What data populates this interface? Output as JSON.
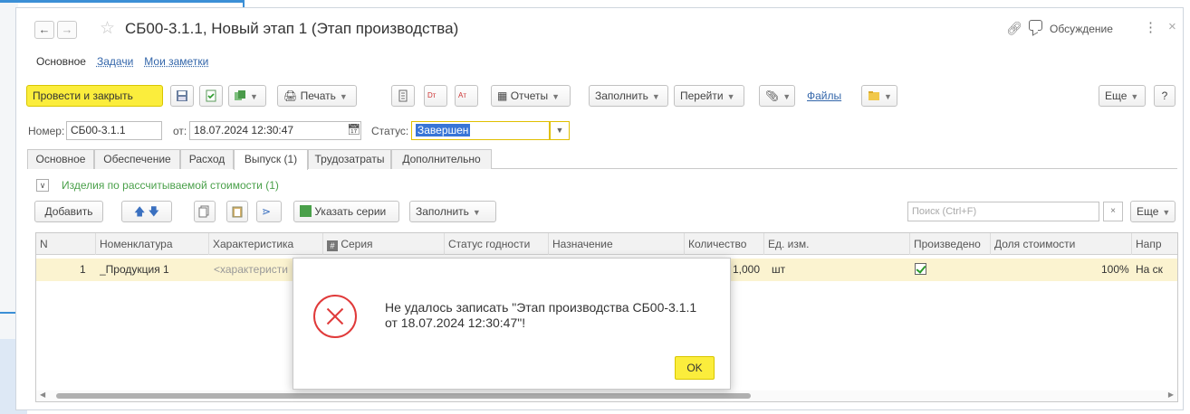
{
  "window": {
    "title": "СБ00-3.1.1, Новый этап 1 (Этап производства)",
    "discussion_label": "Обсуждение"
  },
  "subnav": {
    "items": [
      "Основное",
      "Задачи",
      "Мои заметки"
    ]
  },
  "toolbar": {
    "post_close": "Провести и закрыть",
    "print": "Печать",
    "reports": "Отчеты",
    "fill": "Заполнить",
    "goto": "Перейти",
    "files": "Файлы",
    "more": "Еще",
    "help": "?"
  },
  "header": {
    "number_label": "Номер:",
    "number_value": "СБ00-3.1.1",
    "from_label": "от:",
    "date_value": "18.07.2024 12:30:47",
    "status_label": "Статус:",
    "status_value": "Завершен"
  },
  "doc_tabs": [
    "Основное",
    "Обеспечение",
    "Расход",
    "Выпуск (1)",
    "Трудозатраты",
    "Дополнительно"
  ],
  "group": {
    "title": "Изделия по рассчитываемой стоимости (1)"
  },
  "table_toolbar": {
    "add": "Добавить",
    "specify_series": "Указать серии",
    "fill": "Заполнить",
    "search_placeholder": "Поиск (Ctrl+F)",
    "more": "Еще"
  },
  "grid": {
    "columns": [
      "N",
      "Номенклатура",
      "Характеристика",
      "Серия",
      "Статус годности",
      "Назначение",
      "Количество",
      "Ед. изм.",
      "Произведено",
      "Доля стоимости",
      "Напр"
    ],
    "rows": [
      {
        "n": "1",
        "nomenclature": "_Продукция 1",
        "characteristic": "<характеристи",
        "quantity": "1,000",
        "unit": "шт",
        "produced": true,
        "share": "100%",
        "direction": "На ск"
      }
    ]
  },
  "dialog": {
    "message_line1": "Не удалось записать \"Этап производства СБ00-3.1.1",
    "message_line2": "от 18.07.2024 12:30:47\"!",
    "ok": "OK"
  },
  "colors": {
    "accent_yellow": "#fbed3c",
    "error_red": "#e03a3a",
    "group_green": "#4aa04a",
    "link_blue": "#3366aa",
    "row_highlight": "#fbf3d0"
  }
}
